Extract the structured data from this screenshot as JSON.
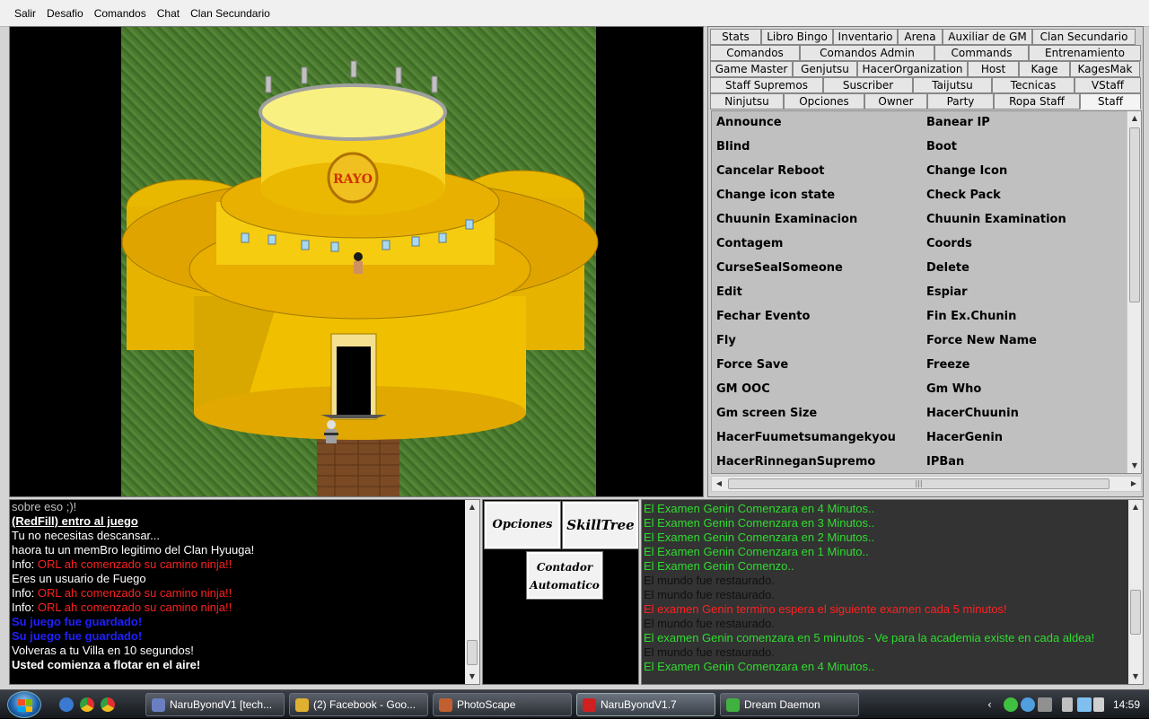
{
  "menubar": [
    "Salir",
    "Desafio",
    "Comandos",
    "Chat",
    "Clan Secundario"
  ],
  "tabs": {
    "row1": [
      "Stats",
      "Libro Bingo",
      "Inventario",
      "Arena",
      "Auxiliar de GM",
      "Clan Secundario"
    ],
    "row2": [
      "Comandos",
      "Comandos Admin",
      "Commands",
      "Entrenamiento"
    ],
    "row3": [
      "Game Master",
      "Genjutsu",
      "HacerOrganization",
      "Host",
      "Kage",
      "KagesMak"
    ],
    "row4": [
      "Staff Supremos",
      "Suscriber",
      "Taijutsu",
      "Tecnicas",
      "VStaff"
    ],
    "row5": [
      "Ninjutsu",
      "Opciones",
      "Owner",
      "Party",
      "Ropa Staff",
      "Staff"
    ],
    "active": "Staff"
  },
  "commands": [
    "Announce",
    "Banear IP",
    "Blind",
    "Boot",
    "Cancelar Reboot",
    "Change Icon",
    "Change icon state",
    "Check Pack",
    "Chuunin Examinacion",
    "Chuunin Examination",
    "Contagem",
    "Coords",
    "CurseSealSomeone",
    "Delete",
    "Edit",
    "Espiar",
    "Fechar Evento",
    "Fin Ex.Chunin",
    "Fly",
    "Force New Name",
    "Force Save",
    "Freeze",
    "GM OOC",
    "Gm Who",
    "Gm screen Size",
    "HacerChuunin",
    "HacerFuumetsumangekyou",
    "HacerGenin",
    "HacerRinneganSupremo",
    "IPBan"
  ],
  "map": {
    "building_sign": "RAYO"
  },
  "chat_lines": [
    {
      "parts": [
        {
          "t": "sobre eso ;)!",
          "c": "#c0c0c0",
          "b": false
        }
      ]
    },
    {
      "parts": [
        {
          "t": " (RedFill) entro al juego",
          "c": "#ffffff",
          "b": true,
          "u": true
        }
      ]
    },
    {
      "parts": [
        {
          "t": "Tu no necesitas descansar...",
          "c": "#ffffff",
          "b": false
        }
      ]
    },
    {
      "parts": [
        {
          "t": "haora tu un memBro legitimo del Clan Hyuuga!",
          "c": "#ffffff",
          "b": false
        }
      ]
    },
    {
      "parts": [
        {
          "t": "Info: ",
          "c": "#ffffff",
          "b": false
        },
        {
          "t": "ORL ah comenzado su camino ninja!!",
          "c": "#ff2020",
          "b": false
        }
      ]
    },
    {
      "parts": [
        {
          "t": "Eres un usuario de Fuego",
          "c": "#ffffff",
          "b": false
        }
      ]
    },
    {
      "parts": [
        {
          "t": "Info: ",
          "c": "#ffffff",
          "b": false
        },
        {
          "t": "ORL ah comenzado su camino ninja!!",
          "c": "#ff2020",
          "b": false
        }
      ]
    },
    {
      "parts": [
        {
          "t": "Info: ",
          "c": "#ffffff",
          "b": false
        },
        {
          "t": "ORL ah comenzado su camino ninja!!",
          "c": "#ff2020",
          "b": false
        }
      ]
    },
    {
      "parts": [
        {
          "t": "Su juego fue guardado!",
          "c": "#2020ff",
          "b": true
        }
      ]
    },
    {
      "parts": [
        {
          "t": "Su juego fue guardado!",
          "c": "#2020ff",
          "b": true
        }
      ]
    },
    {
      "parts": [
        {
          "t": "Volveras a tu Villa en 10 segundos!",
          "c": "#ffffff",
          "b": false
        }
      ]
    },
    {
      "parts": [
        {
          "t": "Usted comienza a flotar en el aire!",
          "c": "#ffffff",
          "b": true
        }
      ]
    }
  ],
  "buttons": {
    "opciones": "Opciones",
    "skilltree": "SkillTree",
    "contador_1": "Contador",
    "contador_2": "Automatico"
  },
  "log_lines": [
    {
      "t": "El Examen Genin Comenzara en 4 Minutos..",
      "c": "#2fdc2f"
    },
    {
      "t": "El Examen Genin Comenzara en 3 Minutos..",
      "c": "#2fdc2f"
    },
    {
      "t": "El Examen Genin Comenzara en 2 Minutos..",
      "c": "#2fdc2f"
    },
    {
      "t": "El Examen Genin Comenzara en 1 Minuto..",
      "c": "#2fdc2f"
    },
    {
      "t": "El Examen Genin Comenzo..",
      "c": "#2fdc2f"
    },
    {
      "t": "El mundo fue restaurado.",
      "c": "#101010"
    },
    {
      "t": "El mundo fue restaurado.",
      "c": "#101010"
    },
    {
      "t": "El examen Genin termino espera el siguiente examen cada 5 minutos!",
      "c": "#ff2020"
    },
    {
      "t": "El mundo fue restaurado.",
      "c": "#101010"
    },
    {
      "t": "El examen Genin comenzara en 5 minutos  - Ve para la academia existe en cada aldea!",
      "c": "#2fdc2f"
    },
    {
      "t": "El mundo fue restaurado.",
      "c": "#101010"
    },
    {
      "t": "El Examen Genin Comenzara en 4 Minutos..",
      "c": "#2fdc2f"
    }
  ],
  "taskbar": {
    "tasks": [
      {
        "label": "NaruByondV1 [tech...",
        "icon": "byond-icon",
        "color": "#6a7fc0"
      },
      {
        "label": "(2) Facebook - Goo...",
        "icon": "chrome-icon",
        "color": "#e0b030"
      },
      {
        "label": "PhotoScape",
        "icon": "photoscape-icon",
        "color": "#c06030"
      },
      {
        "label": "NaruByondV1.7",
        "icon": "byond-red-icon",
        "color": "#d02020"
      },
      {
        "label": "Dream Daemon",
        "icon": "dream-daemon-icon",
        "color": "#40b040"
      }
    ],
    "clock": "14:59"
  }
}
